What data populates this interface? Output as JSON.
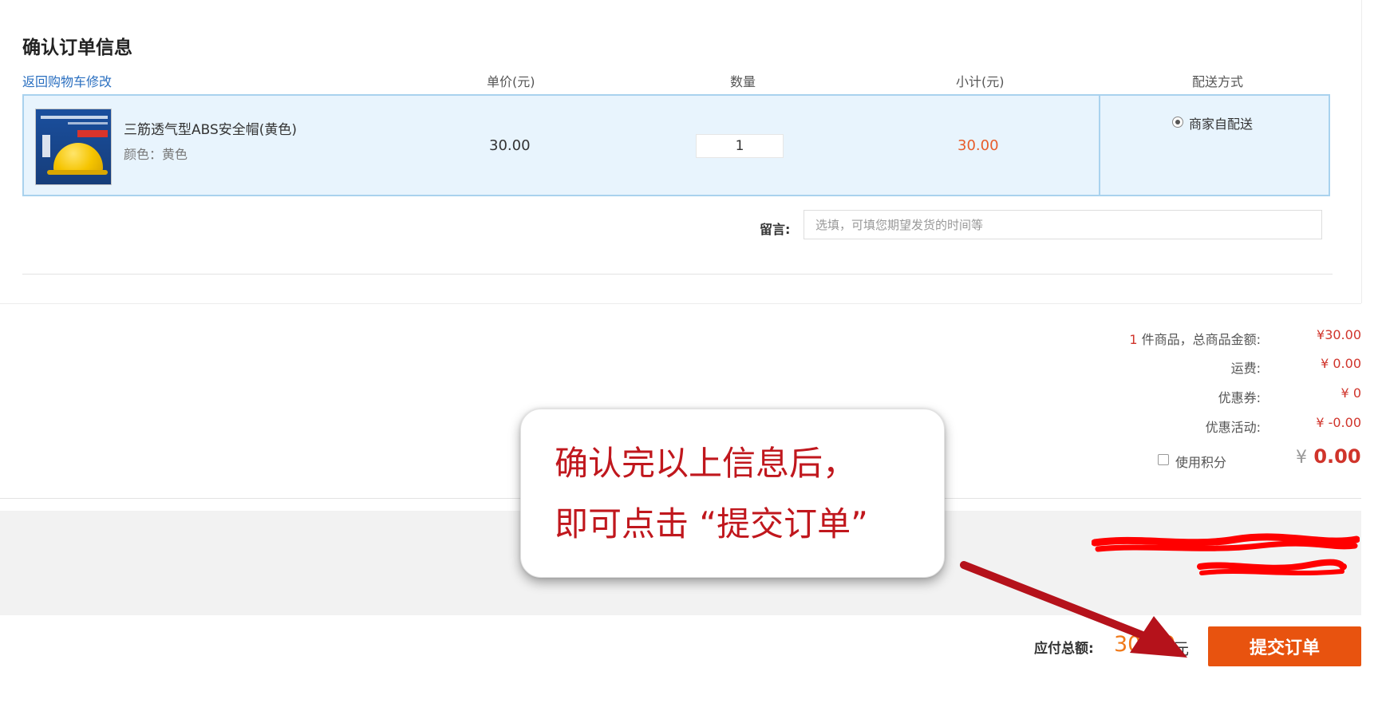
{
  "header": {
    "title": "确认订单信息",
    "back_link": "返回购物车修改",
    "columns": {
      "unit_price": "单价(元)",
      "quantity": "数量",
      "subtotal": "小计(元)",
      "shipping": "配送方式"
    }
  },
  "item": {
    "name": "三筋透气型ABS安全帽(黄色)",
    "color": "颜色：黄色",
    "unit_price": "30.00",
    "quantity": "1",
    "subtotal": "30.00",
    "shipping_option": "商家自配送",
    "shipping_selected": true
  },
  "remark": {
    "label": "留言:",
    "placeholder": "选填，可填您期望发货的时间等"
  },
  "summary": {
    "count": "1",
    "count_label": "件商品，总商品金额:",
    "goods_amount": "¥30.00",
    "freight_label": "运费:",
    "freight": "¥ 0.00",
    "coupon_label": "优惠券:",
    "coupon": "¥ 0",
    "promo_label": "优惠活动:",
    "promo": "¥ -0.00",
    "points_label": "使用积分",
    "points_checked": false,
    "points_currency": "¥",
    "points_amount": "0.00"
  },
  "footer": {
    "total_label": "应付总额:",
    "total_amount": "30.00",
    "total_unit": "元",
    "submit_label": "提交订单"
  },
  "annotation": {
    "line1": "确认完以上信息后，",
    "line2": "即可点击 “提交订单”",
    "text_color": "#c0171d",
    "arrow_color": "#b5121b"
  },
  "colors": {
    "accent_orange": "#e8530f",
    "price_red": "#d0342b",
    "link_blue": "#2a6fc0",
    "row_highlight": "#e8f4fd"
  }
}
